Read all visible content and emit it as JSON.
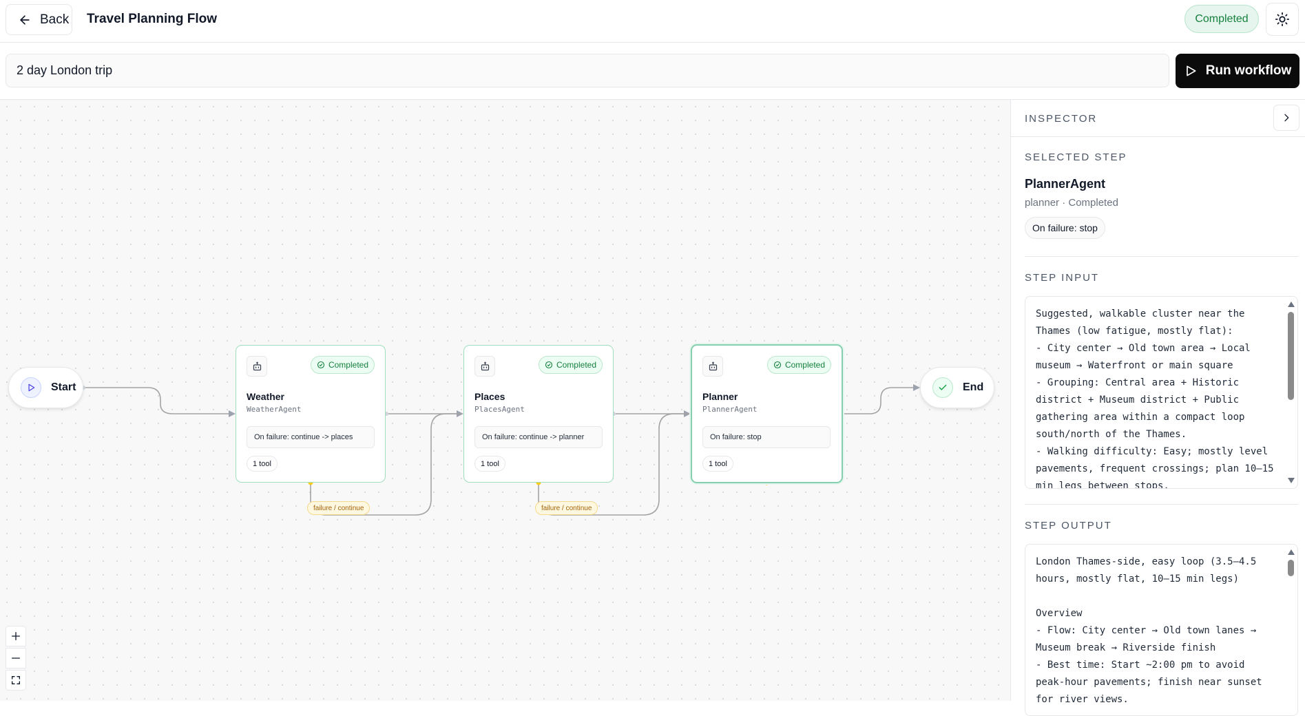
{
  "header": {
    "back_label": "Back",
    "title": "Travel Planning Flow",
    "status": "Completed"
  },
  "prompt": {
    "value": "2 day London trip",
    "run_label": "Run workflow"
  },
  "canvas": {
    "start_label": "Start",
    "end_label": "End",
    "edge_labels": [
      "failure / continue",
      "failure / continue"
    ],
    "steps": [
      {
        "title": "Weather",
        "agent": "WeatherAgent",
        "status": "Completed",
        "failure": "On failure: continue -> places",
        "tools": "1 tool"
      },
      {
        "title": "Places",
        "agent": "PlacesAgent",
        "status": "Completed",
        "failure": "On failure: continue -> planner",
        "tools": "1 tool"
      },
      {
        "title": "Planner",
        "agent": "PlannerAgent",
        "status": "Completed",
        "failure": "On failure: stop",
        "tools": "1 tool"
      }
    ]
  },
  "inspector": {
    "title": "INSPECTOR",
    "selected_label": "SELECTED STEP",
    "selected_name": "PlannerAgent",
    "selected_meta": "planner · Completed",
    "selected_failure": "On failure: stop",
    "input_label": "STEP INPUT",
    "input_text": "Suggested, walkable cluster near the Thames (low fatigue, mostly flat):\n- City center → Old town area → Local museum → Waterfront or main square\n- Grouping: Central area + Historic district + Museum district + Public gathering area within a compact loop south/north of the Thames.\n- Walking difficulty: Easy; mostly level pavements, frequent crossings; plan 10–15 min legs between stops.",
    "output_label": "STEP OUTPUT",
    "output_text": "London Thames-side, easy loop (3.5–4.5 hours, mostly flat, 10–15 min legs)\n\nOverview\n- Flow: City center → Old town lanes → Museum break → Riverside finish\n- Best time: Start ~2:00 pm to avoid peak-hour pavements; finish near sunset for river views."
  },
  "colors": {
    "completed_green": "#15803d",
    "edge_gray": "#9ca3af",
    "failure_yellow": "#facc15",
    "accent_dark": "#0b0b0b"
  }
}
